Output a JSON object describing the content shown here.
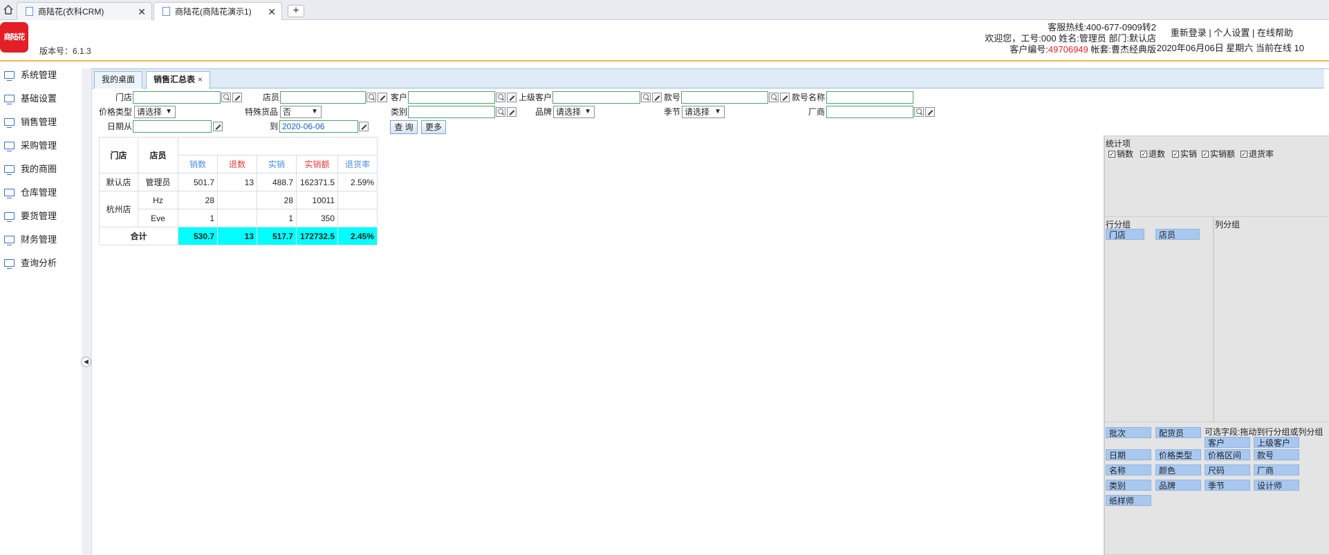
{
  "browser": {
    "tabs": [
      {
        "label": "商陆花(衣科CRM)"
      },
      {
        "label": "商陆花(商陆花演示1)"
      }
    ],
    "new_tab": "+",
    "close": "✕"
  },
  "header": {
    "logo_text": "商陆花",
    "version": "版本号：6.1.3",
    "hotline": "客服热线:400-677-0909转2",
    "welcome": "欢迎您，工号:000 姓名:管理员 部门:默认店",
    "account_prefix": "客户编号:",
    "account_no": "49706949",
    "account_suffix": " 帐套:曹杰经典版",
    "links": "重新登录 | 个人设置 | 在线帮助",
    "date_line": "2020年06月06日 星期六 当前在线 10",
    "accent_color": "#f0b84d"
  },
  "sidebar": {
    "items": [
      {
        "label": "系统管理"
      },
      {
        "label": "基础设置"
      },
      {
        "label": "销售管理"
      },
      {
        "label": "采购管理"
      },
      {
        "label": "我的商圈"
      },
      {
        "label": "仓库管理"
      },
      {
        "label": "要货管理"
      },
      {
        "label": "财务管理"
      },
      {
        "label": "查询分析"
      }
    ]
  },
  "page_tabs": [
    {
      "label": "我的桌面"
    },
    {
      "label": "销售汇总表",
      "close": "×"
    }
  ],
  "filters": {
    "store": "门店",
    "staff": "店员",
    "customer": "客户",
    "parent_customer": "上级客户",
    "style_no": "款号",
    "style_name": "款号名称",
    "price_type": "价格类型",
    "price_type_value": "请选择",
    "special": "特殊货品",
    "special_value": "否",
    "category": "类别",
    "brand": "品牌",
    "brand_value": "请选择",
    "season": "季节",
    "season_value": "请选择",
    "vendor": "厂商",
    "date_from": "日期从",
    "date_to": "到",
    "date_to_value": "2020-06-06",
    "query_button": "查 询",
    "more_button": "更多"
  },
  "report": {
    "headers": {
      "store": "门店",
      "staff": "店员",
      "sales_qty": "销数",
      "return_qty": "退数",
      "net_qty": "实销",
      "net_amount": "实销额",
      "return_rate": "退货率"
    },
    "rows": [
      {
        "store": "默认店",
        "staff": "管理员",
        "sales_qty": "501.7",
        "return_qty": "13",
        "net_qty": "488.7",
        "net_amount": "162371.5",
        "return_rate": "2.59%"
      },
      {
        "store": "杭州店",
        "staff": "Hz",
        "sales_qty": "28",
        "return_qty": "",
        "net_qty": "28",
        "net_amount": "10011",
        "return_rate": ""
      },
      {
        "store": "",
        "staff": "Eve",
        "sales_qty": "1",
        "return_qty": "",
        "net_qty": "1",
        "net_amount": "350",
        "return_rate": ""
      }
    ],
    "total": {
      "label": "合计",
      "sales_qty": "530.7",
      "return_qty": "13",
      "net_qty": "517.7",
      "net_amount": "172732.5",
      "return_rate": "2.45%"
    },
    "total_color": "#00ffff"
  },
  "right_panel": {
    "stat_title": "统计项",
    "stat_items": [
      {
        "label": "销数",
        "checked": true,
        "mark": "✓"
      },
      {
        "label": "退数",
        "checked": true,
        "mark": "✓"
      },
      {
        "label": "实销",
        "checked": true,
        "mark": "✓"
      },
      {
        "label": "实销额",
        "checked": true,
        "mark": "✓"
      },
      {
        "label": "退货率",
        "checked": true,
        "mark": "✓"
      }
    ],
    "row_group_title": "行分组",
    "row_group_items": [
      "门店",
      "店员"
    ],
    "col_group_title": "列分组",
    "optional_title": "可选字段:拖动到行分组或列分组",
    "optional_fields": [
      "批次",
      "配货员",
      "客户",
      "上级客户",
      "日期",
      "价格类型",
      "价格区间",
      "款号",
      "名称",
      "颜色",
      "尺码",
      "厂商",
      "类别",
      "品牌",
      "季节",
      "设计师",
      "纸样师"
    ]
  }
}
